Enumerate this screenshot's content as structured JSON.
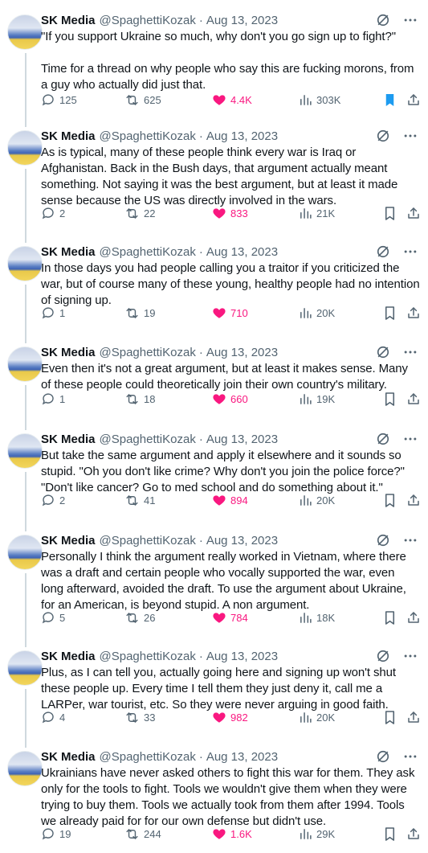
{
  "author": {
    "name": "SK Media",
    "handle": "@SpaghettiKozak",
    "separator": "·"
  },
  "colors": {
    "like": "#f91880",
    "bookmark_active": "#1d9bf0",
    "muted": "#536471",
    "text": "#0f1419",
    "thread_line": "#cfd9de"
  },
  "icons": {
    "header": [
      "grok-icon",
      "more-icon"
    ],
    "actions": [
      "reply-icon",
      "retweet-icon",
      "like-icon",
      "views-icon",
      "bookmark-icon",
      "share-icon"
    ]
  },
  "tweets": [
    {
      "date": "Aug 13, 2023",
      "text": "\"If you support Ukraine so much, why don't you go sign up to fight?\"\n\nTime for a thread on why people who say this are fucking morons, from a guy who actually did just that.",
      "replies": "125",
      "retweets": "625",
      "likes": "4.4K",
      "views": "303K",
      "bookmarked": true
    },
    {
      "date": "Aug 13, 2023",
      "text": "As is typical, many of these people think every war is Iraq or Afghanistan. Back in the Bush days, that argument actually meant something. Not saying it was the best argument, but at least it made sense because the US was directly involved in the wars.",
      "replies": "2",
      "retweets": "22",
      "likes": "833",
      "views": "21K",
      "bookmarked": false
    },
    {
      "date": "Aug 13, 2023",
      "text": "In those days you had people calling you a traitor if you criticized the war, but of course many of these young, healthy people had no intention of signing up.",
      "replies": "1",
      "retweets": "19",
      "likes": "710",
      "views": "20K",
      "bookmarked": false
    },
    {
      "date": "Aug 13, 2023",
      "text": "Even then it's not a great argument, but at least it makes sense. Many of these people could theoretically join their own country's military.",
      "replies": "1",
      "retweets": "18",
      "likes": "660",
      "views": "19K",
      "bookmarked": false
    },
    {
      "date": "Aug 13, 2023",
      "text": "But take the same argument and apply it elsewhere and it sounds so stupid. \"Oh you don't like crime? Why don't you join the police force?\" \"Don't like cancer? Go to med school and do something about it.\"",
      "replies": "2",
      "retweets": "41",
      "likes": "894",
      "views": "20K",
      "bookmarked": false
    },
    {
      "date": "Aug 13, 2023",
      "text": "Personally I think the argument really worked in Vietnam, where there was a draft and certain people who vocally supported the war, even long afterward, avoided the draft. To use the argument about Ukraine, for an American, is beyond stupid. A non argument.",
      "replies": "5",
      "retweets": "26",
      "likes": "784",
      "views": "18K",
      "bookmarked": false
    },
    {
      "date": "Aug 13, 2023",
      "text": "Plus, as I can tell you, actually going here and signing up won't shut these people up. Every time I tell them they just deny it, call me a LARPer, war tourist, etc. So they were never arguing in good faith.",
      "replies": "4",
      "retweets": "33",
      "likes": "982",
      "views": "20K",
      "bookmarked": false
    },
    {
      "date": "Aug 13, 2023",
      "text": "Ukrainians have never asked others to fight this war for them. They ask only for the tools to fight. Tools we wouldn't give them when they were trying to buy them. Tools we actually took from them after 1994. Tools we already paid for for our own defense but didn't use.",
      "replies": "19",
      "retweets": "244",
      "likes": "1.6K",
      "views": "29K",
      "bookmarked": false
    }
  ]
}
